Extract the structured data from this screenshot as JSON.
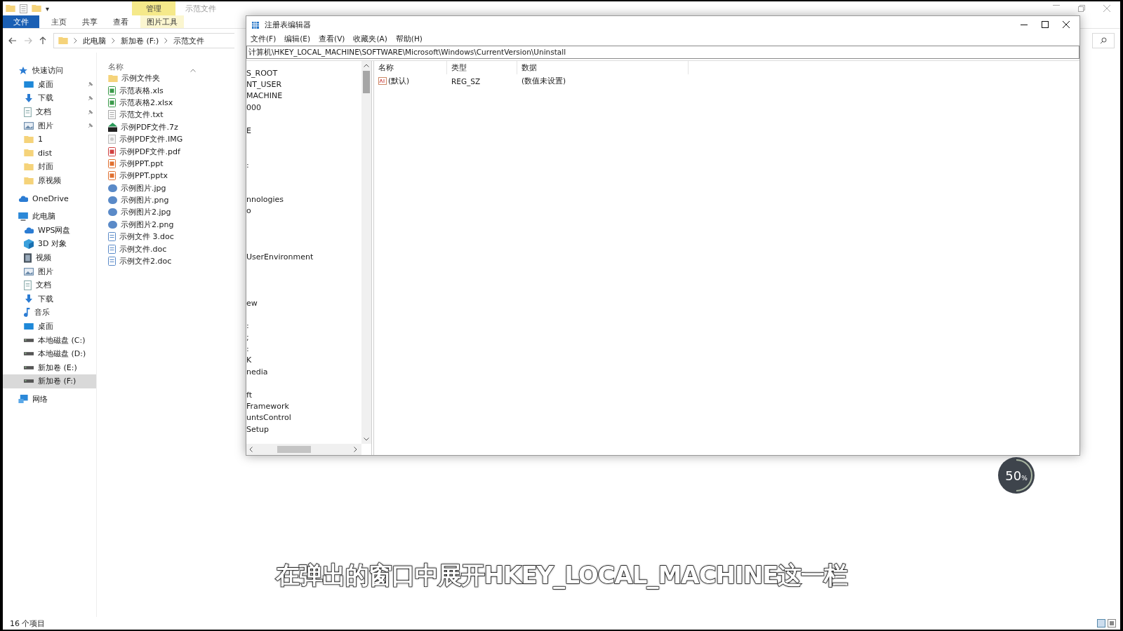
{
  "explorer": {
    "quick_toolbar": "▾",
    "context_tab": "管理",
    "title": "示范文件",
    "ribbon_tabs": [
      {
        "label": "文件",
        "kind": "file",
        "selected": false
      },
      {
        "label": "主页",
        "kind": "tab",
        "selected": false
      },
      {
        "label": "共享",
        "kind": "tab",
        "selected": false
      },
      {
        "label": "查看",
        "kind": "tab",
        "selected": false
      },
      {
        "label": "图片工具",
        "kind": "context",
        "selected": false
      }
    ],
    "breadcrumb": [
      "此电脑",
      "新加卷 (F:)",
      "示范文件"
    ],
    "column_header": "名称",
    "nav": [
      {
        "label": "快速访问",
        "kind": "star",
        "pinned": false,
        "selected": false,
        "children": [
          {
            "label": "桌面",
            "kind": "desktop",
            "pinned": true,
            "selected": false
          },
          {
            "label": "下载",
            "kind": "download",
            "pinned": true,
            "selected": false
          },
          {
            "label": "文档",
            "kind": "doc",
            "pinned": true,
            "selected": false
          },
          {
            "label": "图片",
            "kind": "picture",
            "pinned": true,
            "selected": false
          },
          {
            "label": "1",
            "kind": "folder",
            "pinned": false,
            "selected": false
          },
          {
            "label": "dist",
            "kind": "folder",
            "pinned": false,
            "selected": false
          },
          {
            "label": "封面",
            "kind": "folder",
            "pinned": false,
            "selected": false
          },
          {
            "label": "原视频",
            "kind": "folder",
            "pinned": false,
            "selected": false
          }
        ]
      },
      {
        "label": "OneDrive",
        "kind": "cloud",
        "pinned": false,
        "selected": false
      },
      {
        "label": "此电脑",
        "kind": "pc",
        "pinned": false,
        "selected": false,
        "children": [
          {
            "label": "WPS网盘",
            "kind": "cloud",
            "pinned": false,
            "selected": false
          },
          {
            "label": "3D 对象",
            "kind": "cube",
            "pinned": false,
            "selected": false
          },
          {
            "label": "视频",
            "kind": "video",
            "pinned": false,
            "selected": false
          },
          {
            "label": "图片",
            "kind": "picture",
            "pinned": false,
            "selected": false
          },
          {
            "label": "文档",
            "kind": "doc",
            "pinned": false,
            "selected": false
          },
          {
            "label": "下载",
            "kind": "download",
            "pinned": false,
            "selected": false
          },
          {
            "label": "音乐",
            "kind": "music",
            "pinned": false,
            "selected": false
          },
          {
            "label": "桌面",
            "kind": "desktop",
            "pinned": false,
            "selected": false
          },
          {
            "label": "本地磁盘 (C:)",
            "kind": "drive",
            "pinned": false,
            "selected": false
          },
          {
            "label": "本地磁盘 (D:)",
            "kind": "drive",
            "pinned": false,
            "selected": false
          },
          {
            "label": "新加卷 (E:)",
            "kind": "drive",
            "pinned": false,
            "selected": false
          },
          {
            "label": "新加卷 (F:)",
            "kind": "drive",
            "pinned": false,
            "selected": true
          }
        ]
      },
      {
        "label": "网络",
        "kind": "network",
        "pinned": false,
        "selected": false
      }
    ],
    "files": [
      {
        "name": "示例文件夹",
        "kind": "folder"
      },
      {
        "name": "示范表格.xls",
        "kind": "sheet"
      },
      {
        "name": "示范表格2.xlsx",
        "kind": "sheet"
      },
      {
        "name": "示范文件.txt",
        "kind": "text"
      },
      {
        "name": "示例PDF文件.7z",
        "kind": "archive"
      },
      {
        "name": "示例PDF文件.IMG",
        "kind": "disc"
      },
      {
        "name": "示例PDF文件.pdf",
        "kind": "pdf"
      },
      {
        "name": "示例PPT.ppt",
        "kind": "slides"
      },
      {
        "name": "示例PPT.pptx",
        "kind": "slides"
      },
      {
        "name": "示例图片.jpg",
        "kind": "image"
      },
      {
        "name": "示例图片.png",
        "kind": "image"
      },
      {
        "name": "示例图片2.jpg",
        "kind": "image"
      },
      {
        "name": "示例图片2.png",
        "kind": "image"
      },
      {
        "name": "示例文件 3.doc",
        "kind": "word"
      },
      {
        "name": "示例文件.doc",
        "kind": "word"
      },
      {
        "name": "示例文件2.doc",
        "kind": "word"
      }
    ],
    "status": "16 个项目"
  },
  "regedit": {
    "title": "注册表编辑器",
    "menu": [
      "文件(F)",
      "编辑(E)",
      "查看(V)",
      "收藏夹(A)",
      "帮助(H)"
    ],
    "address": "计算机\\HKEY_LOCAL_MACHINE\\SOFTWARE\\Microsoft\\Windows\\CurrentVersion\\Uninstall",
    "tree": [
      {
        "kind": "key",
        "text": "S_ROOT"
      },
      {
        "kind": "key",
        "text": "NT_USER"
      },
      {
        "kind": "key",
        "text": "MACHINE"
      },
      {
        "kind": "key",
        "text": "000"
      },
      {
        "kind": "clipped"
      },
      {
        "kind": "key",
        "text": "E"
      },
      {
        "kind": "clipped"
      },
      {
        "kind": "clipped"
      },
      {
        "kind": "key",
        "text": ":"
      },
      {
        "kind": "clipped"
      },
      {
        "kind": "clipped"
      },
      {
        "kind": "key",
        "text": "nnologies"
      },
      {
        "kind": "key",
        "text": "o"
      },
      {
        "kind": "clipped"
      },
      {
        "kind": "clipped"
      },
      {
        "kind": "clipped"
      },
      {
        "kind": "key",
        "text": "UserEnvironment"
      },
      {
        "kind": "clipped"
      },
      {
        "kind": "clipped"
      },
      {
        "kind": "clipped"
      },
      {
        "kind": "key",
        "text": "ew"
      },
      {
        "kind": "clipped"
      },
      {
        "kind": "key",
        "text": ":"
      },
      {
        "kind": "key",
        "text": ";"
      },
      {
        "kind": "key",
        "text": ":"
      },
      {
        "kind": "key",
        "text": "K"
      },
      {
        "kind": "key",
        "text": "nedia"
      },
      {
        "kind": "clipped"
      },
      {
        "kind": "key",
        "text": "ft"
      },
      {
        "kind": "key",
        "text": "Framework"
      },
      {
        "kind": "key",
        "text": "untsControl"
      },
      {
        "kind": "key",
        "text": "Setup"
      }
    ],
    "columns": [
      "名称",
      "类型",
      "数据"
    ],
    "values": [
      {
        "name": "(默认)",
        "type": "REG_SZ",
        "data": "(数值未设置)"
      }
    ]
  },
  "overlay": {
    "progress": {
      "number": "50",
      "unit": "%",
      "level": 0.5
    },
    "caption": "在弹出的窗口中展开HKEY_LOCAL_MACHINE这一栏"
  }
}
